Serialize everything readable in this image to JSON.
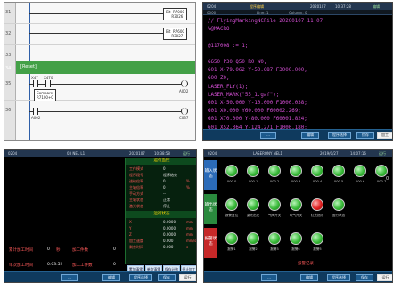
{
  "ladder": {
    "rungs": [
      {
        "n": "31"
      },
      {
        "n": "32"
      },
      {
        "n": "33"
      },
      {
        "n": "34"
      },
      {
        "n": "35"
      },
      {
        "n": "36"
      }
    ],
    "coil_top_1": "Bit  R7000\n     R3026",
    "coil_top_2": "Bit  R7600\n     R3027",
    "reset_label": "[Reset]",
    "contact_a": "X47",
    "contact_b": "X470",
    "compare_a": "Compare",
    "compare_b": "R7100+0",
    "out_a": "A002",
    "out_b": "A002",
    "out_c": "C037"
  },
  "program": {
    "title": "程序编辑",
    "hdr_left": "0204",
    "hdr_mid": "03 NEL L1",
    "hdr_date": "2020107",
    "hdr_time": "10:37:28",
    "hdr_right": "编辑",
    "sub_a": "0000",
    "sub_b": "Line: 1",
    "sub_c": "Column: 0",
    "lines": [
      "// FlyingMarkingNCFile 20200107 11:07",
      "%@MACRO",
      "",
      "@117008 := 1;",
      "",
      "G650 P30 Q50 R0 W0;",
      "G01 X-79.062 Y-50.687 F3000.000;",
      "G00 Z0;",
      "LASER_FLY(1);",
      "LASER_MARK(\"55_1.gaf\");",
      "G01 X-50.000 Y-10.000 F1000.038;",
      "G01 X0.000 Y60.000 F60002.269;",
      "G01 X70.000 Y-80.000 F60001.824;",
      "G01 X52.364 Y-124.271 F1000.180;"
    ],
    "softkeys": [
      "...",
      "编辑",
      "程序选择",
      "保存",
      "加工"
    ]
  },
  "stats": {
    "hdr_left": "0204",
    "hdr_mid": "03 NEL L1",
    "hdr_date": "2020107",
    "hdr_time": "10:38:58",
    "hdr_right": "运行",
    "left_rows": [
      {
        "k": "累计加工时间",
        "v": "0",
        "u": "秒"
      },
      {
        "k": "单次加工时间",
        "v": "0:03:52",
        "u": ""
      }
    ],
    "mid_rows": [
      {
        "k": "加工件数",
        "v": "0",
        "u": ""
      },
      {
        "k": "加工工件数",
        "v": "0",
        "u": ""
      }
    ],
    "sec1_title": "运行监控",
    "sec1_rows": [
      {
        "k": "工作模式",
        "v": "0",
        "u": ""
      },
      {
        "k": "程序段号",
        "v": "程序结束",
        "u": ""
      },
      {
        "k": "进给倍率",
        "v": "0",
        "u": "%"
      },
      {
        "k": "主轴倍率",
        "v": "0",
        "u": "%"
      },
      {
        "k": "手动方式",
        "v": "--",
        "u": ""
      },
      {
        "k": "主轴状态",
        "v": "正常",
        "u": ""
      },
      {
        "k": "激光状态",
        "v": "停止",
        "u": ""
      }
    ],
    "sec2_title": "运行状态",
    "sec2_rows": [
      {
        "k": "X",
        "v": "0.0000",
        "u": "mm"
      },
      {
        "k": "Y",
        "v": "0.0000",
        "u": "mm"
      },
      {
        "k": "Z",
        "v": "0.0000",
        "u": "mm"
      },
      {
        "k": "加工速度",
        "v": "0.000",
        "u": "mm/s"
      },
      {
        "k": "剩余时间",
        "v": "0.000",
        "u": "s"
      }
    ],
    "actions": [
      "累加清零",
      "单次清零",
      "保存计数",
      "停止加工"
    ],
    "softkeys": [
      "...",
      "编辑",
      "程序选择",
      "保存",
      "运行"
    ]
  },
  "io": {
    "hdr_left": "0204",
    "hdr_mid": "LASERONY NEL1",
    "hdr_date": "2019/0/27",
    "hdr_time": "14:07:16",
    "hdr_right": "运行",
    "groups": [
      {
        "label": "输入状态",
        "color": "#2b6bb8",
        "lights": [
          {
            "s": "on",
            "t": "X00.0"
          },
          {
            "s": "on",
            "t": "X00.1"
          },
          {
            "s": "on",
            "t": "X00.2"
          },
          {
            "s": "on",
            "t": "X00.3"
          },
          {
            "s": "on",
            "t": "X00.4"
          },
          {
            "s": "on",
            "t": "X00.5"
          },
          {
            "s": "on",
            "t": "X00.6"
          },
          {
            "s": "on",
            "t": "X00.7"
          }
        ]
      },
      {
        "label": "输出状态",
        "color": "#2a8a3e",
        "lights": [
          {
            "s": "on",
            "t": "报警复位"
          },
          {
            "s": "on",
            "t": "激光出光"
          },
          {
            "s": "on",
            "t": "气阀开关"
          },
          {
            "s": "on",
            "t": "吹气开关"
          },
          {
            "s": "red",
            "t": "红光指示"
          },
          {
            "s": "on",
            "t": "运行状态"
          }
        ]
      },
      {
        "label": "报警状态",
        "color": "#c62828",
        "lights": [
          {
            "s": "on",
            "t": "报警1"
          },
          {
            "s": "on",
            "t": "报警2"
          },
          {
            "s": "on",
            "t": "报警3"
          },
          {
            "s": "on",
            "t": "报警4"
          },
          {
            "s": "on",
            "t": "报警5"
          }
        ]
      }
    ],
    "center_label": "报警记录",
    "extra": "0",
    "softkeys": [
      "...",
      "编辑",
      "程序选择",
      "保存",
      "运行"
    ]
  }
}
